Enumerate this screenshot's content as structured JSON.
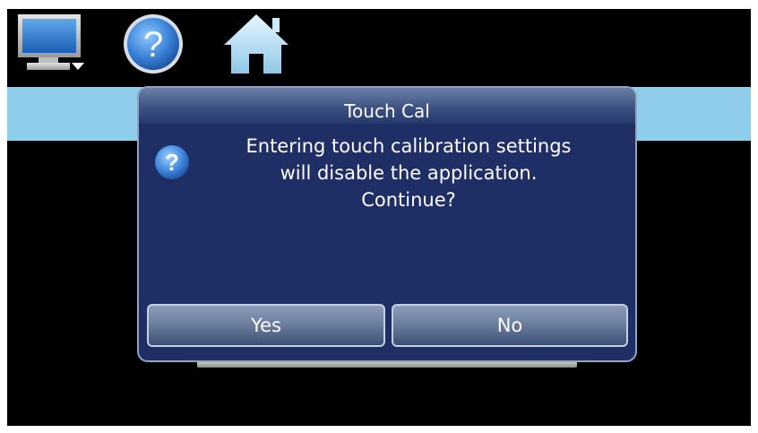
{
  "toolbar": {
    "monitor_icon": "monitor-icon",
    "help_icon": "help-icon",
    "home_icon": "home-icon"
  },
  "dialog": {
    "title": "Touch Cal",
    "icon": "question-icon",
    "message_lines": [
      "Entering touch calibration settings",
      "will disable the application.",
      "Continue?"
    ],
    "yes_label": "Yes",
    "no_label": "No"
  },
  "colors": {
    "screen_background": "#000000",
    "top_bar": "#8fcdeb",
    "dialog_background": "#1f2f66",
    "button": "#6d7f9f",
    "text": "#ffffff"
  }
}
